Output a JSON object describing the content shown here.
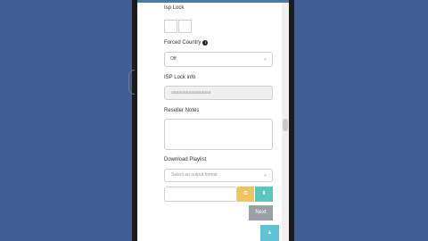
{
  "form": {
    "isp_lock_label": "Isp Lock",
    "forced_country_label": "Forced Country",
    "forced_country_value": "Off",
    "isp_lock_info_label": "ISP Lock info",
    "isp_lock_info_placeholder": "aaaaaaaaaaaaaaaa",
    "reseller_notes_label": "Reseller Notes",
    "download_playlist_label": "Download Playlist",
    "playlist_select_placeholder": "Select an output format",
    "next_label": "Next"
  },
  "icons": {
    "info": "info-icon",
    "chevron": "chevron-down-icon",
    "copy": "copy-icon",
    "download": "download-icon",
    "scroll_top": "arrow-up-icon"
  },
  "colors": {
    "background": "#3f5e94",
    "copy_button": "#f2c45e",
    "download_button": "#5cc5bd",
    "next_button": "#9aa0a6",
    "scroll_top_button": "#5fc2d6"
  }
}
